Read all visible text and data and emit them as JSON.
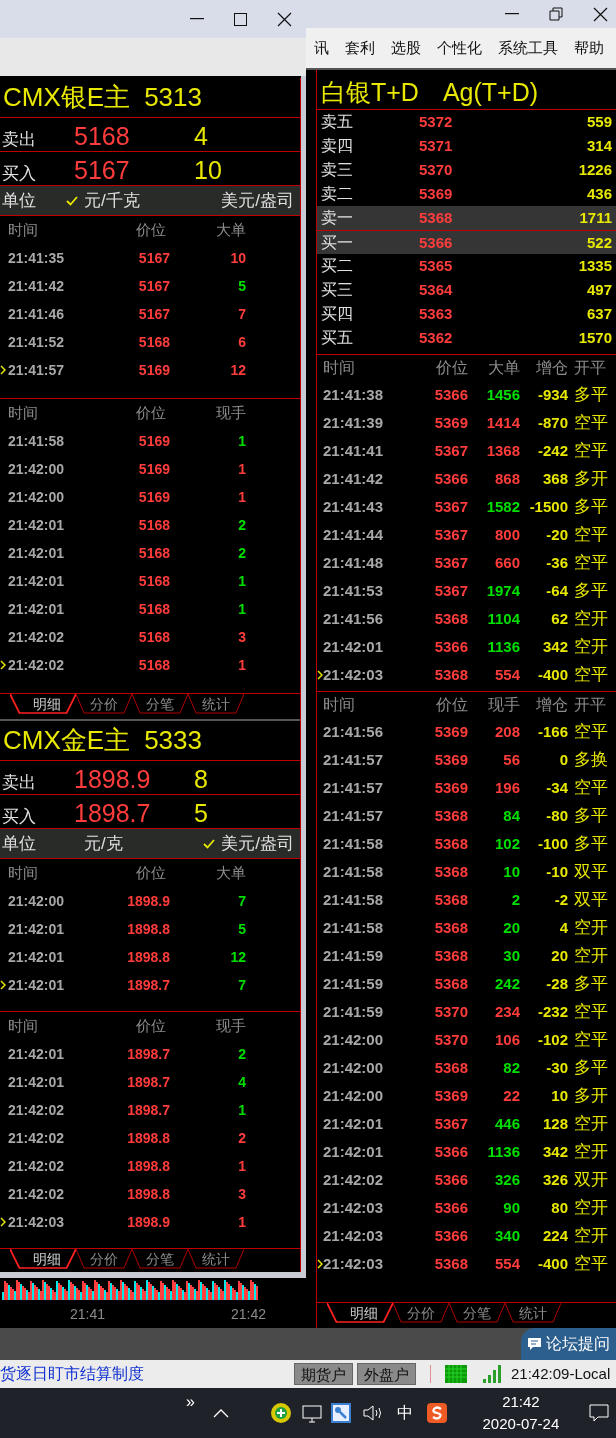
{
  "main_window": {
    "menu": [
      {
        "label": "讯"
      },
      {
        "label": "套利"
      },
      {
        "label": "选股"
      },
      {
        "label": "个性化"
      },
      {
        "label": "系统工具"
      },
      {
        "label": "帮助"
      }
    ]
  },
  "left_window": {
    "instruments": [
      {
        "title": "CMX银E主",
        "code": "5313",
        "quotes": [
          {
            "label": "卖出",
            "price": "5168",
            "volume": "4"
          },
          {
            "label": "买入",
            "price": "5167",
            "volume": "10"
          }
        ],
        "unit_label": "单位",
        "units": [
          {
            "label": "元/千克",
            "selected": true
          },
          {
            "label": "美元/盎司",
            "selected": false
          }
        ],
        "big_orders": {
          "columns": [
            "时间",
            "价位",
            "大单"
          ],
          "rows": [
            {
              "time": "21:41:35",
              "price": "5167",
              "volume": "10",
              "color": "#ff3c3c",
              "latest": false
            },
            {
              "time": "21:41:42",
              "price": "5167",
              "volume": "5",
              "color": "#00e000",
              "latest": false
            },
            {
              "time": "21:41:46",
              "price": "5167",
              "volume": "7",
              "color": "#ff3c3c",
              "latest": false
            },
            {
              "time": "21:41:52",
              "price": "5168",
              "volume": "6",
              "color": "#ff3c3c",
              "latest": false
            },
            {
              "time": "21:41:57",
              "price": "5169",
              "volume": "12",
              "color": "#ff3c3c",
              "latest": true
            }
          ]
        },
        "ticks": {
          "columns": [
            "时间",
            "价位",
            "现手"
          ],
          "rows": [
            {
              "time": "21:41:58",
              "price": "5169",
              "volume": "1",
              "color": "#00e000",
              "latest": false
            },
            {
              "time": "21:42:00",
              "price": "5169",
              "volume": "1",
              "color": "#ff3c3c",
              "latest": false
            },
            {
              "time": "21:42:00",
              "price": "5169",
              "volume": "1",
              "color": "#ff3c3c",
              "latest": false
            },
            {
              "time": "21:42:01",
              "price": "5168",
              "volume": "2",
              "color": "#00e000",
              "latest": false
            },
            {
              "time": "21:42:01",
              "price": "5168",
              "volume": "2",
              "color": "#00e000",
              "latest": false
            },
            {
              "time": "21:42:01",
              "price": "5168",
              "volume": "1",
              "color": "#00e000",
              "latest": false
            },
            {
              "time": "21:42:01",
              "price": "5168",
              "volume": "1",
              "color": "#00e000",
              "latest": false
            },
            {
              "time": "21:42:02",
              "price": "5168",
              "volume": "3",
              "color": "#ff3c3c",
              "latest": false
            },
            {
              "time": "21:42:02",
              "price": "5168",
              "volume": "1",
              "color": "#ff3c3c",
              "latest": true
            }
          ]
        },
        "tabs": [
          {
            "label": "明细",
            "selected": true
          },
          {
            "label": "分价",
            "selected": false
          },
          {
            "label": "分笔",
            "selected": false
          },
          {
            "label": "统计",
            "selected": false
          }
        ]
      },
      {
        "title": "CMX金E主",
        "code": "5333",
        "quotes": [
          {
            "label": "卖出",
            "price": "1898.9",
            "volume": "8"
          },
          {
            "label": "买入",
            "price": "1898.7",
            "volume": "5"
          }
        ],
        "unit_label": "单位",
        "units": [
          {
            "label": "元/克",
            "selected": false
          },
          {
            "label": "美元/盎司",
            "selected": true
          }
        ],
        "big_orders": {
          "columns": [
            "时间",
            "价位",
            "大单"
          ],
          "rows": [
            {
              "time": "21:42:00",
              "price": "1898.9",
              "volume": "7",
              "color": "#00e000",
              "latest": false
            },
            {
              "time": "21:42:01",
              "price": "1898.8",
              "volume": "5",
              "color": "#00e000",
              "latest": false
            },
            {
              "time": "21:42:01",
              "price": "1898.8",
              "volume": "12",
              "color": "#00e000",
              "latest": false
            },
            {
              "time": "21:42:01",
              "price": "1898.7",
              "volume": "7",
              "color": "#00e000",
              "latest": true
            }
          ]
        },
        "ticks": {
          "columns": [
            "时间",
            "价位",
            "现手"
          ],
          "rows": [
            {
              "time": "21:42:01",
              "price": "1898.7",
              "volume": "2",
              "color": "#00e000",
              "latest": false
            },
            {
              "time": "21:42:01",
              "price": "1898.7",
              "volume": "4",
              "color": "#00e000",
              "latest": false
            },
            {
              "time": "21:42:02",
              "price": "1898.7",
              "volume": "1",
              "color": "#00e000",
              "latest": false
            },
            {
              "time": "21:42:02",
              "price": "1898.8",
              "volume": "2",
              "color": "#ff3c3c",
              "latest": false
            },
            {
              "time": "21:42:02",
              "price": "1898.8",
              "volume": "1",
              "color": "#ff3c3c",
              "latest": false
            },
            {
              "time": "21:42:02",
              "price": "1898.8",
              "volume": "3",
              "color": "#ff3c3c",
              "latest": false
            },
            {
              "time": "21:42:03",
              "price": "1898.9",
              "volume": "1",
              "color": "#ff3c3c",
              "latest": true
            }
          ]
        },
        "tabs": [
          {
            "label": "明细",
            "selected": true
          },
          {
            "label": "分价",
            "selected": false
          },
          {
            "label": "分笔",
            "selected": false
          },
          {
            "label": "统计",
            "selected": false
          }
        ]
      }
    ]
  },
  "quote_panel": {
    "title": "白银T+D",
    "code": "Ag(T+D)",
    "order_book": [
      {
        "label": "卖五",
        "price": "5372",
        "volume": "559",
        "highlighted": false
      },
      {
        "label": "卖四",
        "price": "5371",
        "volume": "314",
        "highlighted": false
      },
      {
        "label": "卖三",
        "price": "5370",
        "volume": "1226",
        "highlighted": false
      },
      {
        "label": "卖二",
        "price": "5369",
        "volume": "436",
        "highlighted": false
      },
      {
        "label": "卖一",
        "price": "5368",
        "volume": "1711",
        "highlighted": true
      },
      {
        "label": "买一",
        "price": "5366",
        "volume": "522",
        "highlighted": true
      },
      {
        "label": "买二",
        "price": "5365",
        "volume": "1335",
        "highlighted": false
      },
      {
        "label": "买三",
        "price": "5364",
        "volume": "497",
        "highlighted": false
      },
      {
        "label": "买四",
        "price": "5363",
        "volume": "637",
        "highlighted": false
      },
      {
        "label": "买五",
        "price": "5362",
        "volume": "1570",
        "highlighted": false
      }
    ],
    "big_orders": {
      "columns": [
        "时间",
        "价位",
        "大单",
        "增仓",
        "开平"
      ],
      "rows": [
        {
          "time": "21:41:38",
          "price": "5366",
          "volume": "1456",
          "color": "#00e000",
          "change": "-934",
          "type": "多平",
          "latest": false
        },
        {
          "time": "21:41:39",
          "price": "5369",
          "volume": "1414",
          "color": "#ff3c3c",
          "change": "-870",
          "type": "空平",
          "latest": false
        },
        {
          "time": "21:41:41",
          "price": "5367",
          "volume": "1368",
          "color": "#ff3c3c",
          "change": "-242",
          "type": "空平",
          "latest": false
        },
        {
          "time": "21:41:42",
          "price": "5366",
          "volume": "868",
          "color": "#ff3c3c",
          "change": "368",
          "type": "多开",
          "latest": false
        },
        {
          "time": "21:41:43",
          "price": "5367",
          "volume": "1582",
          "color": "#00e000",
          "change": "-1500",
          "type": "多平",
          "latest": false
        },
        {
          "time": "21:41:44",
          "price": "5367",
          "volume": "800",
          "color": "#ff3c3c",
          "change": "-20",
          "type": "空平",
          "latest": false
        },
        {
          "time": "21:41:48",
          "price": "5367",
          "volume": "660",
          "color": "#ff3c3c",
          "change": "-36",
          "type": "空平",
          "latest": false
        },
        {
          "time": "21:41:53",
          "price": "5367",
          "volume": "1974",
          "color": "#00e000",
          "change": "-64",
          "type": "多平",
          "latest": false
        },
        {
          "time": "21:41:56",
          "price": "5368",
          "volume": "1104",
          "color": "#00e000",
          "change": "62",
          "type": "空开",
          "latest": false
        },
        {
          "time": "21:42:01",
          "price": "5366",
          "volume": "1136",
          "color": "#00e000",
          "change": "342",
          "type": "空开",
          "latest": false
        },
        {
          "time": "21:42:03",
          "price": "5368",
          "volume": "554",
          "color": "#ff3c3c",
          "change": "-400",
          "type": "空平",
          "latest": true
        }
      ]
    },
    "ticks": {
      "columns": [
        "时间",
        "价位",
        "现手",
        "增仓",
        "开平"
      ],
      "rows": [
        {
          "time": "21:41:56",
          "price": "5369",
          "volume": "208",
          "color": "#ff3c3c",
          "change": "-166",
          "type": "空平",
          "latest": false
        },
        {
          "time": "21:41:57",
          "price": "5369",
          "volume": "56",
          "color": "#ff3c3c",
          "change": "0",
          "type": "多换",
          "latest": false
        },
        {
          "time": "21:41:57",
          "price": "5369",
          "volume": "196",
          "color": "#ff3c3c",
          "change": "-34",
          "type": "空平",
          "latest": false
        },
        {
          "time": "21:41:57",
          "price": "5368",
          "volume": "84",
          "color": "#00e000",
          "change": "-80",
          "type": "多平",
          "latest": false
        },
        {
          "time": "21:41:58",
          "price": "5368",
          "volume": "102",
          "color": "#00e000",
          "change": "-100",
          "type": "多平",
          "latest": false
        },
        {
          "time": "21:41:58",
          "price": "5368",
          "volume": "10",
          "color": "#00e000",
          "change": "-10",
          "type": "双平",
          "latest": false
        },
        {
          "time": "21:41:58",
          "price": "5368",
          "volume": "2",
          "color": "#00e000",
          "change": "-2",
          "type": "双平",
          "latest": false
        },
        {
          "time": "21:41:58",
          "price": "5368",
          "volume": "20",
          "color": "#00e000",
          "change": "4",
          "type": "空开",
          "latest": false
        },
        {
          "time": "21:41:59",
          "price": "5368",
          "volume": "30",
          "color": "#00e000",
          "change": "20",
          "type": "空开",
          "latest": false
        },
        {
          "time": "21:41:59",
          "price": "5368",
          "volume": "242",
          "color": "#00e000",
          "change": "-28",
          "type": "多平",
          "latest": false
        },
        {
          "time": "21:41:59",
          "price": "5370",
          "volume": "234",
          "color": "#ff3c3c",
          "change": "-232",
          "type": "空平",
          "latest": false
        },
        {
          "time": "21:42:00",
          "price": "5370",
          "volume": "106",
          "color": "#ff3c3c",
          "change": "-102",
          "type": "空平",
          "latest": false
        },
        {
          "time": "21:42:00",
          "price": "5368",
          "volume": "82",
          "color": "#00e000",
          "change": "-30",
          "type": "多平",
          "latest": false
        },
        {
          "time": "21:42:00",
          "price": "5369",
          "volume": "22",
          "color": "#ff3c3c",
          "change": "10",
          "type": "多开",
          "latest": false
        },
        {
          "time": "21:42:01",
          "price": "5367",
          "volume": "446",
          "color": "#00e000",
          "change": "128",
          "type": "空开",
          "latest": false
        },
        {
          "time": "21:42:01",
          "price": "5366",
          "volume": "1136",
          "color": "#00e000",
          "change": "342",
          "type": "空开",
          "latest": false
        },
        {
          "time": "21:42:02",
          "price": "5366",
          "volume": "326",
          "color": "#00e000",
          "change": "326",
          "type": "双开",
          "latest": false
        },
        {
          "time": "21:42:03",
          "price": "5366",
          "volume": "90",
          "color": "#00e000",
          "change": "80",
          "type": "空开",
          "latest": false
        },
        {
          "time": "21:42:03",
          "price": "5366",
          "volume": "340",
          "color": "#00e000",
          "change": "224",
          "type": "空开",
          "latest": false
        },
        {
          "time": "21:42:03",
          "price": "5368",
          "volume": "554",
          "color": "#ff3c3c",
          "change": "-400",
          "type": "空平",
          "latest": true
        }
      ]
    },
    "tabs": [
      {
        "label": "明细",
        "selected": true
      },
      {
        "label": "分价",
        "selected": false
      },
      {
        "label": "分笔",
        "selected": false
      },
      {
        "label": "统计",
        "selected": false
      }
    ]
  },
  "chart_axis": {
    "labels": [
      "21:41",
      "21:42"
    ]
  },
  "forum_button": "论坛提问",
  "status_bar": {
    "notice": "货逐日盯市结算制度",
    "account_buttons": [
      "期货户",
      "外盘户"
    ],
    "clock": "21:42:09-Local"
  },
  "taskbar": {
    "overflow": "»",
    "ime": "中",
    "time": "21:42",
    "date": "2020-07-24"
  }
}
